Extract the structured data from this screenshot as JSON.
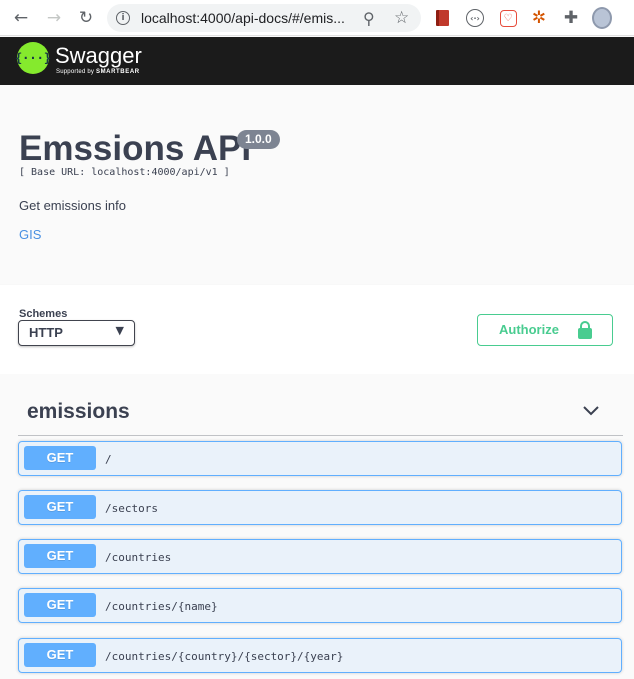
{
  "browser": {
    "back_icon": "arrow-left",
    "forward_icon": "arrow-right",
    "reload_icon": "reload",
    "url": "localhost:4000/api-docs/#/emis...",
    "extensions": [
      "book-extension",
      "code-extension",
      "heart-extension",
      "fox-extension",
      "puzzle-icon",
      "profile-avatar"
    ]
  },
  "topbar": {
    "logo_text": "Swagger",
    "logo_sub_prefix": "Supported by",
    "logo_sub_brand": "SMARTBEAR",
    "logo_mark": "{···}",
    "bg_color": "#1b1b1b",
    "logo_color": "#85ea2d"
  },
  "info": {
    "title": "Emssions API",
    "version": "1.0.0",
    "base_url": "[ Base URL: localhost:4000/api/v1 ]",
    "description": "Get emissions info",
    "link": "GIS"
  },
  "schemes": {
    "label": "Schemes",
    "selected": "HTTP"
  },
  "authorize": {
    "label": "Authorize",
    "color": "#49cc90"
  },
  "tag": {
    "name": "emissions",
    "expanded": true
  },
  "operations": [
    {
      "method": "GET",
      "path": "/"
    },
    {
      "method": "GET",
      "path": "/sectors"
    },
    {
      "method": "GET",
      "path": "/countries"
    },
    {
      "method": "GET",
      "path": "/countries/{name}"
    },
    {
      "method": "GET",
      "path": "/countries/{country}/{sector}/{year}"
    }
  ],
  "colors": {
    "get_method": "#61affe",
    "link": "#4990e2",
    "text": "#3b4151"
  }
}
